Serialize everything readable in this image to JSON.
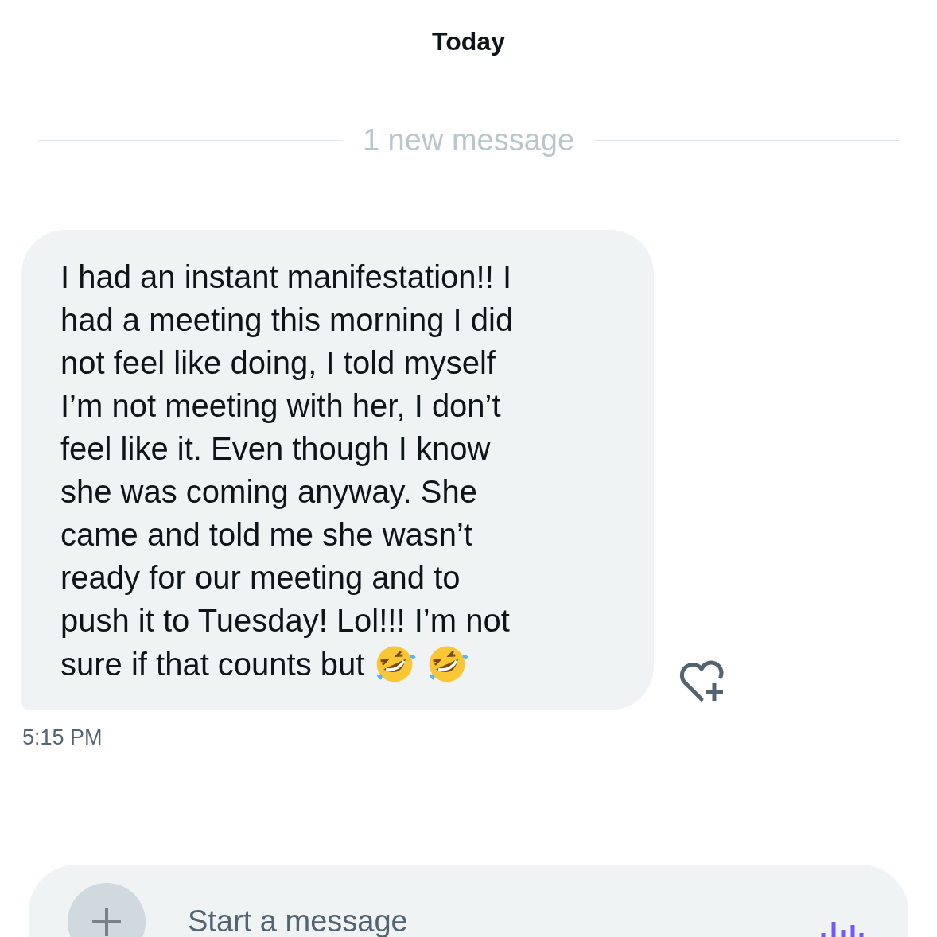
{
  "header": {
    "title": "Today"
  },
  "divider": {
    "label": "1 new message"
  },
  "message": {
    "lines": [
      "I had an instant manifestation!! I",
      "had a meeting this morning I did",
      "not feel like doing, I told myself",
      "I’m not meeting with her, I don’t",
      "feel like it. Even though I know",
      "she was coming anyway. She",
      "came and told me she wasn’t",
      "ready for our meeting and to",
      "push it to Tuesday! Lol!!! I’m not",
      "sure if that counts but"
    ],
    "emojis": [
      {
        "kind": "rofl"
      },
      {
        "kind": "rofl"
      }
    ],
    "time": "5:15 PM"
  },
  "composer": {
    "placeholder": "Start a message"
  }
}
